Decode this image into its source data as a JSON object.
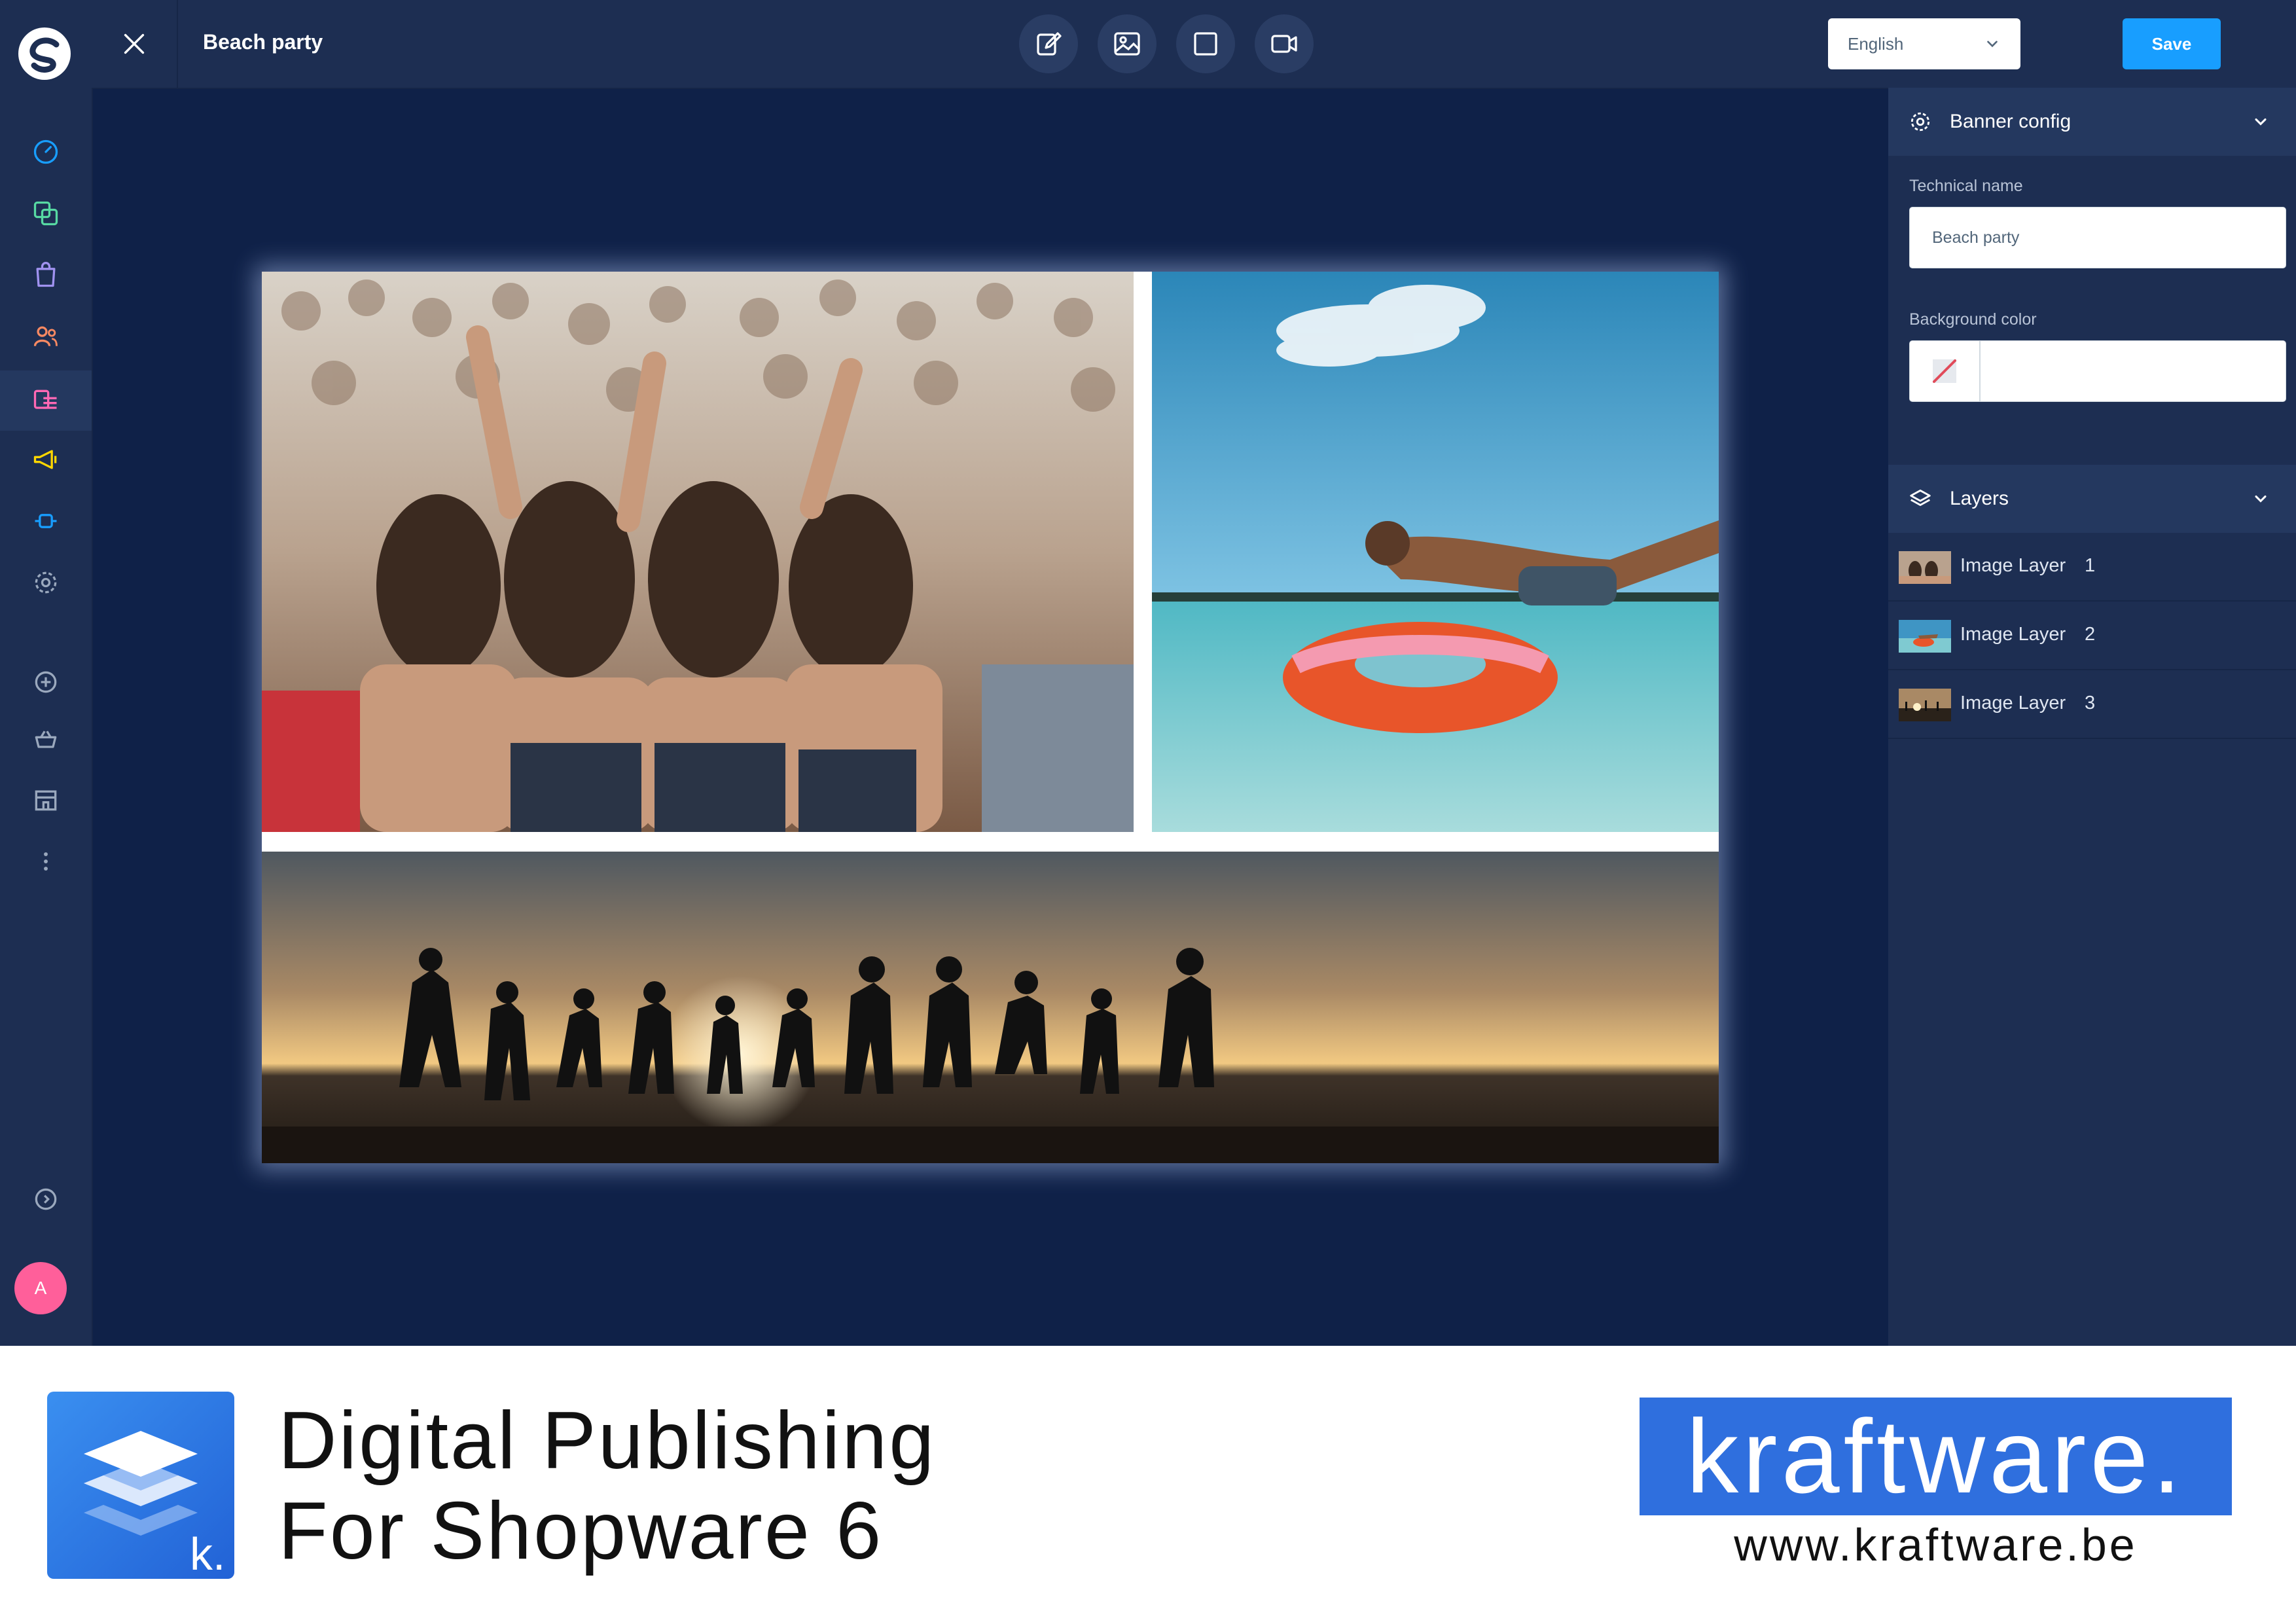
{
  "app": {
    "title": "Beach party",
    "language": "English",
    "save_label": "Save",
    "avatar_initial": "A",
    "toolbar_tools": [
      "edit-icon",
      "image-icon",
      "square-icon",
      "video-icon"
    ],
    "nav_icons": [
      "dashboard-icon",
      "catalogue-icon",
      "orders-icon",
      "customers-icon",
      "content-icon",
      "marketing-icon",
      "extensions-icon",
      "settings-icon",
      "add-icon",
      "basket-icon",
      "store-icon",
      "more-icon",
      "expand-icon"
    ],
    "colors": {
      "sidebar": "#1d2e52",
      "canvas": "#0f2148",
      "accent": "#189eff",
      "avatar": "#ff5f9a",
      "content_nav": "#ff68b4",
      "marketing_nav": "#ffd700"
    }
  },
  "panel": {
    "banner_config": {
      "heading": "Banner config",
      "technical_name_label": "Technical name",
      "technical_name_value": "Beach party",
      "background_color_label": "Background color"
    },
    "layers": {
      "heading": "Layers",
      "items": [
        {
          "label": "Image Layer",
          "number": "1"
        },
        {
          "label": "Image Layer",
          "number": "2"
        },
        {
          "label": "Image Layer",
          "number": "3"
        }
      ]
    }
  },
  "footer": {
    "title_line1": "Digital Publishing",
    "title_line2": "For Shopware 6",
    "brand": "kraftware.",
    "url": "www.kraftware.be",
    "logo_letter": "k."
  }
}
